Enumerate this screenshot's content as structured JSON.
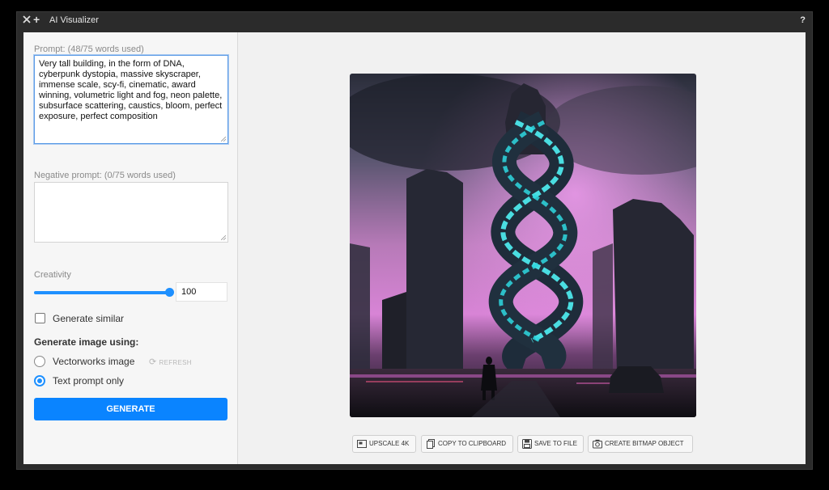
{
  "window": {
    "title": "AI Visualizer",
    "help": "?"
  },
  "sidebar": {
    "prompt_label": "Prompt: (48/75 words used)",
    "prompt_value": "Very tall building, in the form of DNA, cyberpunk dystopia, massive skyscraper, immense scale, scy-fi, cinematic, award winning, volumetric light and fog, neon palette, subsurface scattering, caustics, bloom, perfect exposure, perfect composition",
    "negative_label": "Negative prompt: (0/75 words used)",
    "negative_value": "",
    "creativity_label": "Creativity",
    "creativity_value": "100",
    "generate_similar_label": "Generate similar",
    "generate_similar_checked": false,
    "generate_using_label": "Generate image using:",
    "options": [
      {
        "label": "Vectorworks image",
        "selected": false
      },
      {
        "label": "Text prompt only",
        "selected": true
      }
    ],
    "refresh_label": "REFRESH",
    "generate_button": "GENERATE"
  },
  "toolbar": {
    "upscale": "UPSCALE 4K",
    "copy": "COPY TO CLIPBOARD",
    "save": "SAVE TO FILE",
    "create": "CREATE BITMAP OBJECT"
  },
  "colors": {
    "accent": "#0a84ff",
    "slider": "#1e90ff"
  },
  "icons": [
    "close-icon",
    "plus-icon",
    "help-icon",
    "refresh-icon",
    "upscale-icon",
    "copy-icon",
    "save-icon",
    "camera-icon"
  ]
}
